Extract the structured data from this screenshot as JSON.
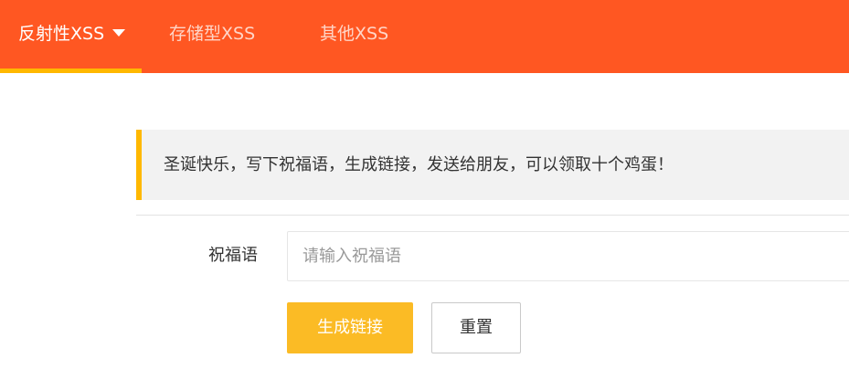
{
  "nav": {
    "items": [
      {
        "label": "反射性XSS",
        "active": true
      },
      {
        "label": "存储型XSS",
        "active": false
      },
      {
        "label": "其他XSS",
        "active": false
      }
    ],
    "colors": {
      "bar": "#ff5722",
      "active_underline": "#ffb800"
    }
  },
  "notice": {
    "text": "圣诞快乐，写下祝福语，生成链接，发送给朋友，可以领取十个鸡蛋！",
    "accent_color": "#ffb800"
  },
  "form": {
    "blessing_label": "祝福语",
    "blessing_value": "",
    "blessing_placeholder": "请输入祝福语",
    "generate_label": "生成链接",
    "reset_label": "重置",
    "generate_color": "#fbbb25"
  }
}
